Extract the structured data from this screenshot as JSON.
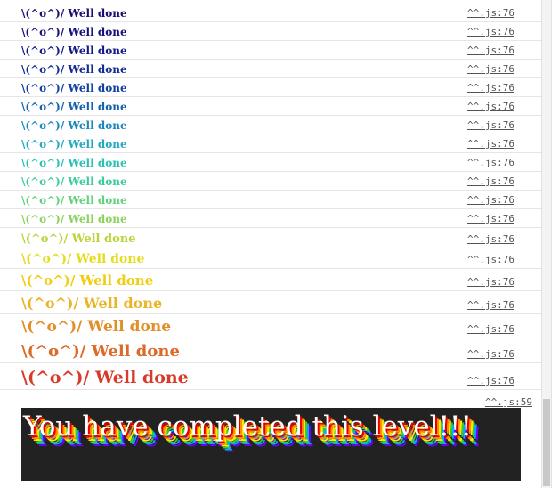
{
  "logs": [
    {
      "text": "\\(^o^)/ Well done",
      "source": "^^.js:76",
      "color": "#1a0f6e"
    },
    {
      "text": "\\(^o^)/ Well done",
      "source": "^^.js:76",
      "color": "#17127a"
    },
    {
      "text": "\\(^o^)/ Well done",
      "source": "^^.js:76",
      "color": "#141a86"
    },
    {
      "text": "\\(^o^)/ Well done",
      "source": "^^.js:76",
      "color": "#122a94"
    },
    {
      "text": "\\(^o^)/ Well done",
      "source": "^^.js:76",
      "color": "#1240a0"
    },
    {
      "text": "\\(^o^)/ Well done",
      "source": "^^.js:76",
      "color": "#1462ae"
    },
    {
      "text": "\\(^o^)/ Well done",
      "source": "^^.js:76",
      "color": "#1b86bb"
    },
    {
      "text": "\\(^o^)/ Well done",
      "source": "^^.js:76",
      "color": "#24a8bf"
    },
    {
      "text": "\\(^o^)/ Well done",
      "source": "^^.js:76",
      "color": "#2cc1b4"
    },
    {
      "text": "\\(^o^)/ Well done",
      "source": "^^.js:76",
      "color": "#3ccc9a"
    },
    {
      "text": "\\(^o^)/ Well done",
      "source": "^^.js:76",
      "color": "#62d07c"
    },
    {
      "text": "\\(^o^)/ Well done",
      "source": "^^.js:76",
      "color": "#8cd25c"
    },
    {
      "text": "\\(^o^)/ Well done",
      "source": "^^.js:76",
      "color": "#b8d63c"
    },
    {
      "text": "\\(^o^)/ Well done",
      "source": "^^.js:76",
      "color": "#e4dc1c"
    },
    {
      "text": "\\(^o^)/ Well done",
      "source": "^^.js:76",
      "color": "#f2cc10"
    },
    {
      "text": "\\(^o^)/ Well done",
      "source": "^^.js:76",
      "color": "#eab424"
    },
    {
      "text": "\\(^o^)/ Well done",
      "source": "^^.js:76",
      "color": "#e08f2a"
    },
    {
      "text": "\\(^o^)/ Well done",
      "source": "^^.js:76",
      "color": "#dc6a28"
    },
    {
      "text": "\\(^o^)/ Well done",
      "source": "^^.js:76",
      "color": "#d83a2a"
    }
  ],
  "final": {
    "text": "You have completed this level!!!",
    "source": "^^.js:59"
  }
}
